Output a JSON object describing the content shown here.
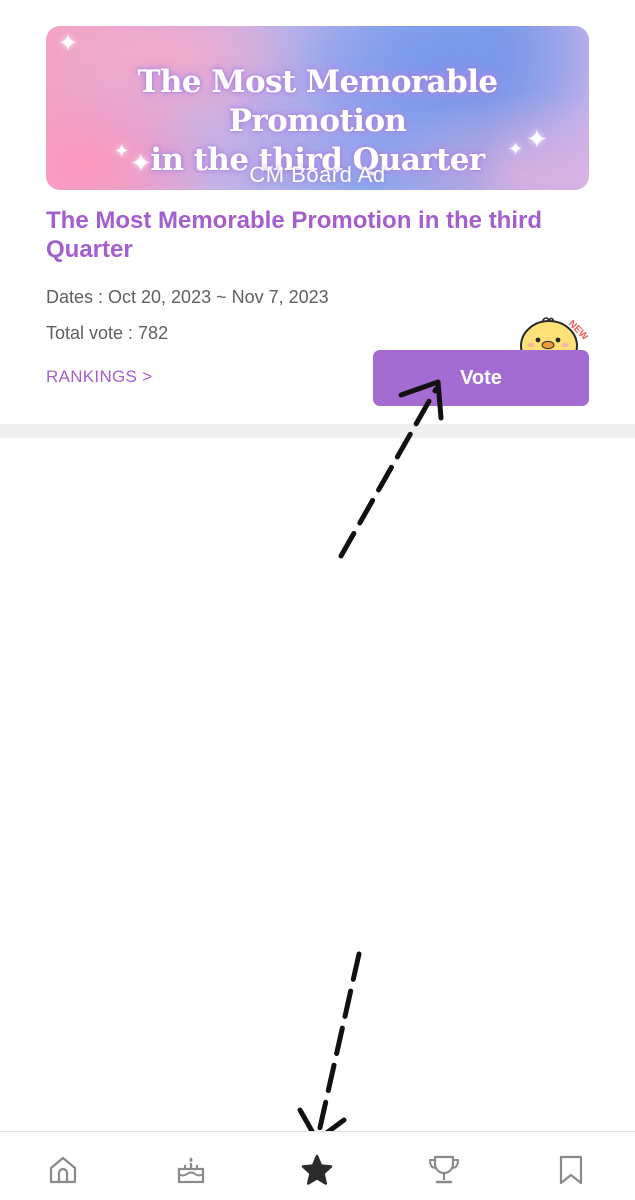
{
  "banner": {
    "title_line1": "The Most Memorable Promotion",
    "title_line2": "in the third Quarter",
    "subtitle": "CM Board Ad"
  },
  "event": {
    "title": "The Most Memorable Promotion in the third Quarter",
    "dates": "Dates : Oct 20, 2023 ~ Nov 7, 2023",
    "total_vote": "Total vote : 782",
    "rankings_label": "RANKINGS >",
    "vote_label": "Vote",
    "new_badge": "NEW"
  },
  "colors": {
    "accent": "#a45fcf",
    "vote_button": "#a46bd3",
    "divider": "#efefef",
    "annotation": "#111111"
  },
  "bottom_nav": {
    "items": [
      {
        "icon": "home-icon",
        "active": false
      },
      {
        "icon": "cake-icon",
        "active": false
      },
      {
        "icon": "star-icon",
        "active": true
      },
      {
        "icon": "trophy-icon",
        "active": false
      },
      {
        "icon": "bookmark-icon",
        "active": false
      }
    ]
  }
}
